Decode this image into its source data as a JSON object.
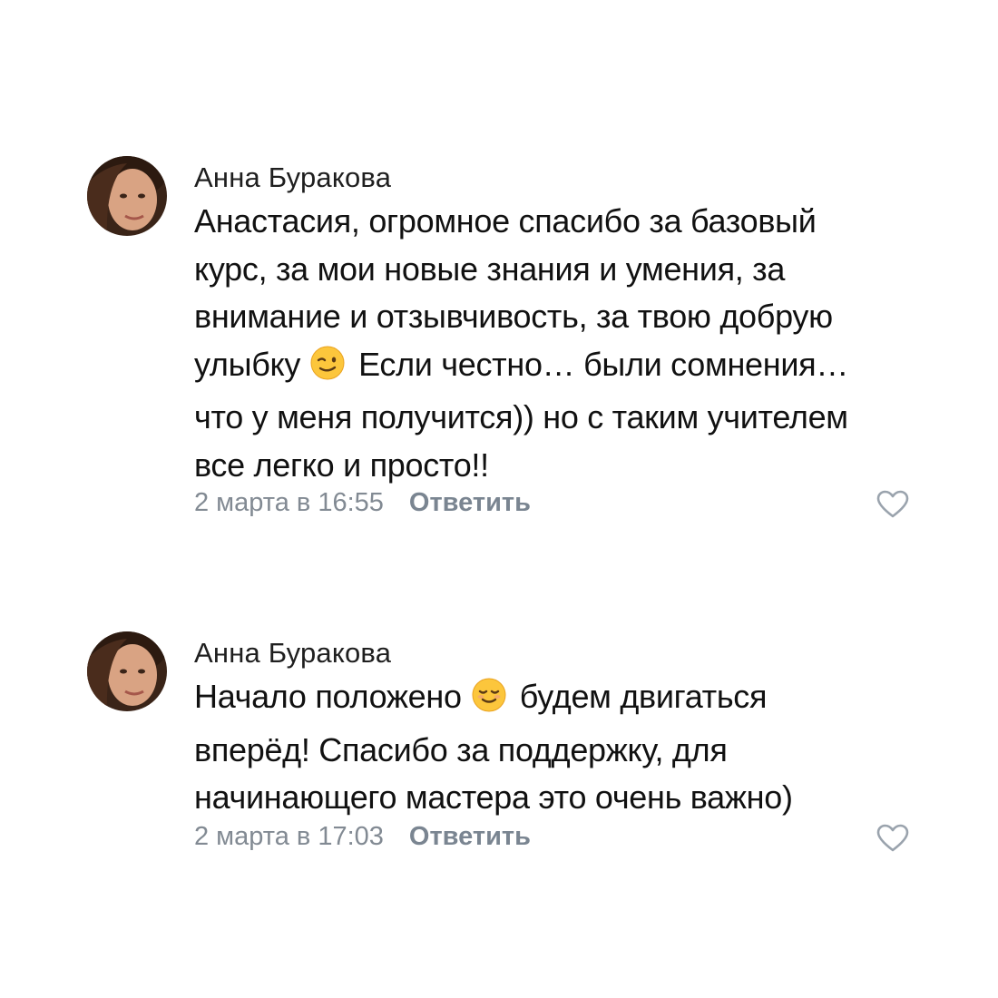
{
  "comments": [
    {
      "author": "Анна Буракова",
      "lines": [
        {
          "before": "Анастасия, огромное спасибо за базовый"
        },
        {
          "before": "курс, за мои новые знания и умения, за"
        },
        {
          "before": "внимание и отзывчивость, за твою добрую"
        },
        {
          "before": "улыбку",
          "emoji": "winking-face-emoji",
          "after": "Если честно… были сомнения…"
        },
        {
          "before": "что у меня получится)) но с таким учителем"
        },
        {
          "before": "все легко и просто!!"
        }
      ],
      "date": "2 марта в 16:55",
      "reply_label": "Ответить",
      "like_icon": "heart-outline-icon"
    },
    {
      "author": "Анна Буракова",
      "lines": [
        {
          "before": "Начало положено",
          "emoji": "smiling-face-emoji",
          "after": "будем двигаться"
        },
        {
          "before": "вперёд! Спасибо за поддержку, для"
        },
        {
          "before": "начинающего мастера это очень важно)"
        }
      ],
      "date": "2 марта в 17:03",
      "reply_label": "Ответить",
      "like_icon": "heart-outline-icon"
    }
  ],
  "colors": {
    "background": "#ffffff",
    "text": "#111111",
    "meta": "#828a93",
    "reply": "#7a8591",
    "icon": "#9aa3ad"
  }
}
